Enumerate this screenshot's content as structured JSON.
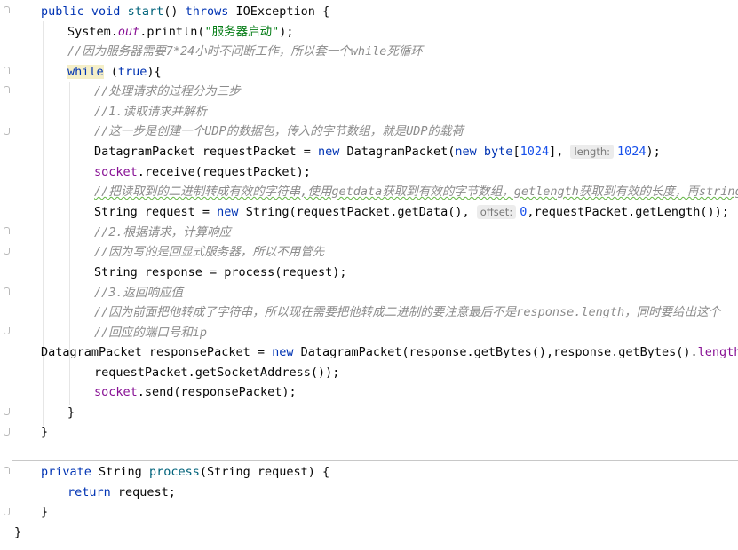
{
  "code": {
    "method_start": {
      "kw_public": "public",
      "kw_void": "void",
      "name": "start",
      "open": "() ",
      "kw_throws": "throws",
      "rest": " IOException {"
    },
    "println": {
      "pre": "System.",
      "field": "out",
      "mid": ".println(",
      "str": "\"服务器启动\"",
      "post": ");"
    },
    "comment_loop": "//因为服务器需要7*24小时不间断工作，所以套一个while死循环",
    "while_line": {
      "kw_while": "while",
      "sp": " (",
      "kw_true": "true",
      "post": "){"
    },
    "comment_steps": "//处理请求的过程分为三步",
    "comment_read": "//1.读取请求并解析",
    "comment_udp": "//这一步是创建一个UDP的数据包，传入的字节数组，就是UDP的载荷",
    "request_packet": {
      "pre": "DatagramPacket requestPacket = ",
      "kw_new": "new",
      "mid": " DatagramPacket(",
      "kw_new2": "new",
      "kw_byte": " byte",
      "br_open": "[",
      "num1": "1024",
      "br_close": "], ",
      "hint": "length:",
      "num2": "1024",
      "post": ");"
    },
    "receive": {
      "field": "socket",
      "post": ".receive(requestPacket);"
    },
    "comment_convert": "//把读取到的二进制转成有效的字符串,使用getdata获取到有效的字节数组，getlength获取到有效的长度，再string",
    "string_request": {
      "pre": "String request = ",
      "kw_new": "new",
      "mid": " String(requestPacket.getData(), ",
      "hint": "offset:",
      "num": "0",
      "post": ",requestPacket.getLength());"
    },
    "comment_respond": "//2.根据请求，计算响应",
    "comment_echo": "//因为写的是回显式服务器，所以不用管先",
    "process_call": "String response = process(request);",
    "comment_return": "//3.返回响应值",
    "comment_length": "//因为前面把他转成了字符串，所以现在需要把他转成二进制的要注意最后不是response.length，同时要给出这个",
    "comment_port": "//回应的端口号和ip",
    "response_packet": {
      "pre": "DatagramPacket responsePacket = ",
      "kw_new": "new",
      "mid": " DatagramPacket(response.getBytes(),response.getBytes().",
      "field": "length",
      "post": ","
    },
    "socket_address": "requestPacket.getSocketAddress());",
    "send": {
      "field": "socket",
      "post": ".send(responsePacket);"
    },
    "close_while": "}",
    "close_method": "}",
    "process_sig": {
      "kw_private": "private",
      "mid": " String ",
      "name": "process",
      "post": "(String request) {"
    },
    "return_line": {
      "kw_return": "return",
      "post": " request;"
    },
    "close_process": "}",
    "close_class": "}"
  }
}
